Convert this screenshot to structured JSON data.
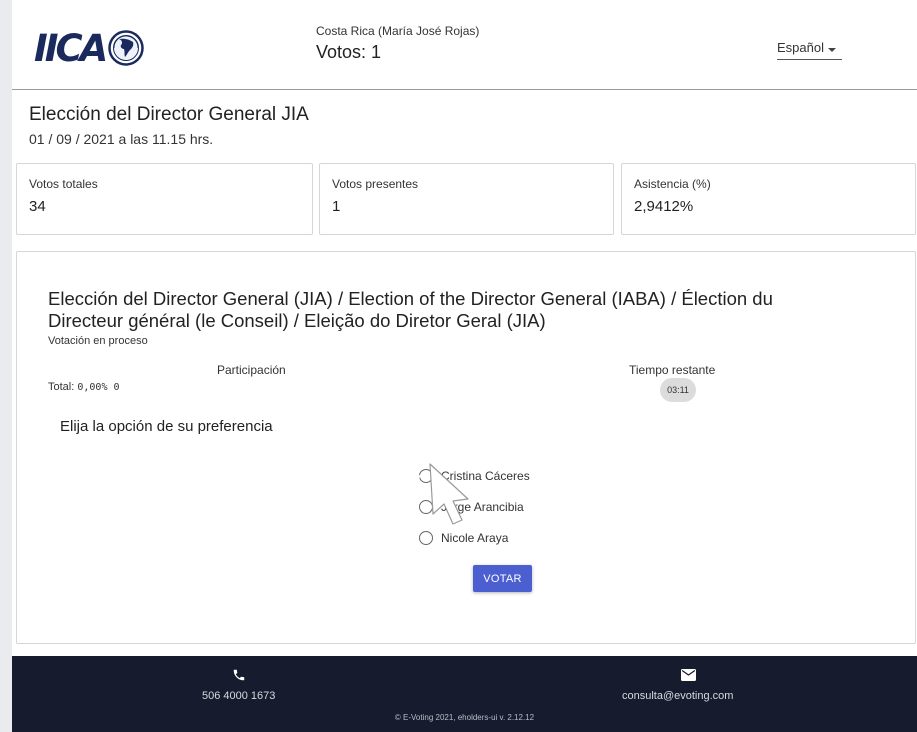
{
  "header": {
    "logo_text": "IICA",
    "voter_name": "Costa Rica (María José Rojas)",
    "votes": "Votos: 1",
    "language": "Español"
  },
  "election": {
    "title": "Elección del Director General JIA",
    "date": "01 / 09 / 2021 a las 11.15 hrs."
  },
  "stats": [
    {
      "label": "Votos totales",
      "value": "34"
    },
    {
      "label": "Votos presentes",
      "value": "1"
    },
    {
      "label": "Asistencia (%)",
      "value": "2,9412%"
    }
  ],
  "ballot": {
    "question": "Elección del Director General (JIA) / Election of the Director General (IABA) / Élection du Directeur général (le Conseil) / Eleição do Diretor Geral (JIA)",
    "status": "Votación en proceso",
    "participation_label": "Participación",
    "total_label": "Total:",
    "total_value": "0,00% 0",
    "time_label": "Tiempo restante",
    "time_value": "03:11",
    "instruction": "Elija la opción de su preferencia",
    "options": [
      {
        "label": "Cristina Cáceres",
        "selected": false
      },
      {
        "label": "Jorge Arancibia",
        "selected": false
      },
      {
        "label": "Nicole Araya",
        "selected": false
      }
    ],
    "vote_button": "VOTAR"
  },
  "footer": {
    "phone": "506 4000 1673",
    "email": "consulta@evoting.com",
    "copyright": "© E-Voting 2021, eholders-ui v. 2.12.12",
    "icons": [
      "phone-icon",
      "mail-icon"
    ]
  },
  "colors": {
    "accent": "#4c5fd0",
    "footer_bg": "#161c2e",
    "logo": "#1a2a5c"
  }
}
